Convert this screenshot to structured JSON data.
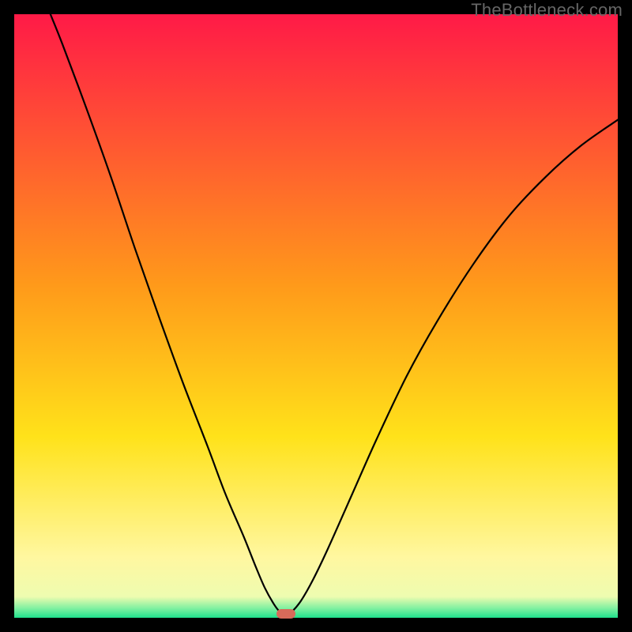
{
  "watermark": "TheBottleneck.com",
  "chart_data": {
    "type": "line",
    "title": "",
    "xlabel": "",
    "ylabel": "",
    "xlim": [
      0,
      100
    ],
    "ylim": [
      0,
      100
    ],
    "grid": false,
    "legend": false,
    "gradient_stops": [
      {
        "offset": 0,
        "color": "#ff1a47"
      },
      {
        "offset": 0.45,
        "color": "#ff9a1a"
      },
      {
        "offset": 0.7,
        "color": "#ffe21a"
      },
      {
        "offset": 0.9,
        "color": "#fff7a0"
      },
      {
        "offset": 0.965,
        "color": "#eefcb0"
      },
      {
        "offset": 0.985,
        "color": "#7cf0a0"
      },
      {
        "offset": 1.0,
        "color": "#1fe08c"
      }
    ],
    "curve_points_norm": [
      {
        "x": 0.06,
        "y": 1.0
      },
      {
        "x": 0.08,
        "y": 0.95
      },
      {
        "x": 0.12,
        "y": 0.843
      },
      {
        "x": 0.16,
        "y": 0.731
      },
      {
        "x": 0.2,
        "y": 0.612
      },
      {
        "x": 0.24,
        "y": 0.498
      },
      {
        "x": 0.28,
        "y": 0.388
      },
      {
        "x": 0.32,
        "y": 0.285
      },
      {
        "x": 0.35,
        "y": 0.205
      },
      {
        "x": 0.38,
        "y": 0.135
      },
      {
        "x": 0.4,
        "y": 0.085
      },
      {
        "x": 0.415,
        "y": 0.05
      },
      {
        "x": 0.43,
        "y": 0.023
      },
      {
        "x": 0.44,
        "y": 0.01
      },
      {
        "x": 0.45,
        "y": 0.004
      },
      {
        "x": 0.46,
        "y": 0.01
      },
      {
        "x": 0.475,
        "y": 0.028
      },
      {
        "x": 0.495,
        "y": 0.063
      },
      {
        "x": 0.52,
        "y": 0.115
      },
      {
        "x": 0.56,
        "y": 0.205
      },
      {
        "x": 0.6,
        "y": 0.295
      },
      {
        "x": 0.65,
        "y": 0.4
      },
      {
        "x": 0.7,
        "y": 0.49
      },
      {
        "x": 0.76,
        "y": 0.585
      },
      {
        "x": 0.82,
        "y": 0.666
      },
      {
        "x": 0.88,
        "y": 0.73
      },
      {
        "x": 0.94,
        "y": 0.783
      },
      {
        "x": 1.0,
        "y": 0.825
      }
    ],
    "marker": {
      "x_norm": 0.45,
      "y_norm": 0.006,
      "color": "#d86a5a"
    }
  }
}
